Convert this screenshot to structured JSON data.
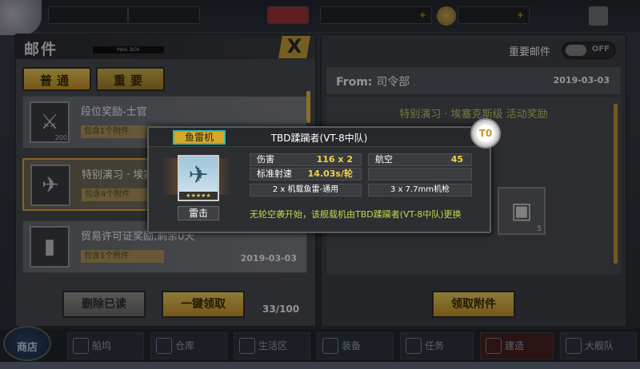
{
  "topbar": {
    "resource1": "",
    "resource2": ""
  },
  "mail_panel": {
    "title": "邮件",
    "subtitle": "MAIL BOX",
    "close_label": "X",
    "tabs": [
      "普通",
      "重要"
    ],
    "mails": [
      {
        "title": "段位奖励-士官",
        "attach": "包含1个附件",
        "count": "200",
        "icon": "swords-icon",
        "date": ""
      },
      {
        "title": "特别演习 · 埃塞克斯级",
        "attach": "包含4个附件",
        "count": "",
        "icon": "plane-icon",
        "date": ""
      },
      {
        "title": "贸易许可证奖励,剩余0天",
        "attach": "包含1个附件",
        "count": "",
        "icon": "permit-icon",
        "date": "2019-03-03"
      }
    ],
    "delete_read": "删除已读",
    "claim_all": "一键领取",
    "count": "33/100"
  },
  "detail_panel": {
    "important_label": "重要邮件",
    "toggle": "OFF",
    "from_label": "From:",
    "sender": "司令部",
    "date": "2019-03-03",
    "mail_title": "特别演习 · 埃塞克斯级 活动奖励",
    "claim_attach": "领取附件",
    "item_count": "5"
  },
  "popup": {
    "tag": "鱼雷机",
    "name": "TBD蹂躏者(VT-8中队)",
    "rank": "T0",
    "type": "雷击",
    "stats": [
      {
        "label": "伤害",
        "value": "116 x 2"
      },
      {
        "label": "航空",
        "value": "45"
      },
      {
        "label": "标准射速",
        "value": "14.03s/轮"
      }
    ],
    "weapons": [
      "2 x 机载鱼雷-通用",
      "3 x 7.7mm机枪"
    ],
    "skill": "无轮空袭开始，该舰载机由TBD蹂躏者(VT-8中队)更换"
  },
  "bottom_nav": {
    "shop": "商店",
    "items": [
      "船坞",
      "仓库",
      "生活区",
      "装备",
      "任务",
      "建造",
      "大舰队"
    ]
  }
}
